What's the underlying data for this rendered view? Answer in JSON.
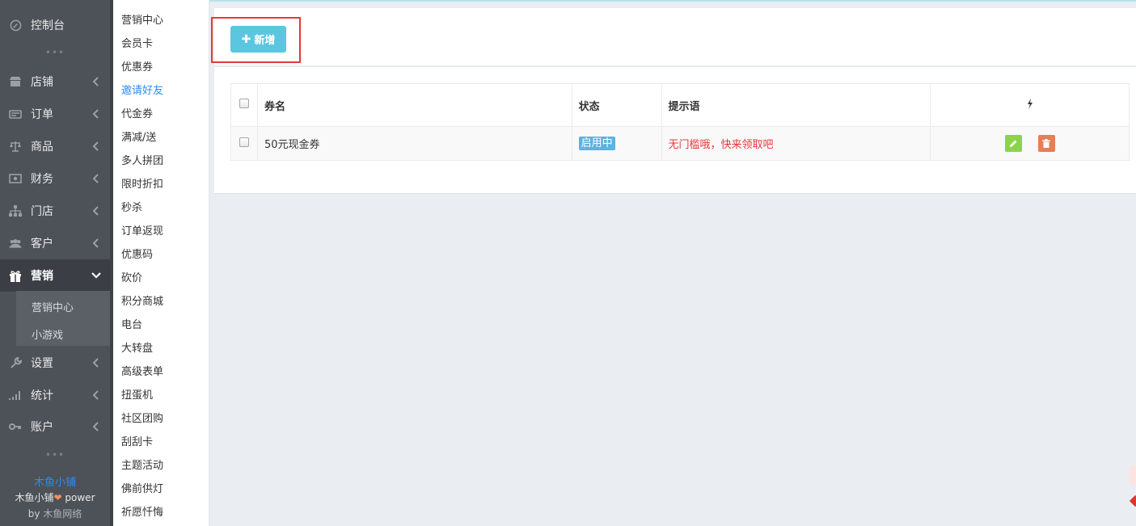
{
  "sidebar": {
    "items": [
      {
        "label": "控制台",
        "icon": "dashboard-icon",
        "has_chevron": false
      },
      {
        "label": "店铺",
        "icon": "shop-icon",
        "has_chevron": true
      },
      {
        "label": "订单",
        "icon": "order-icon",
        "has_chevron": true
      },
      {
        "label": "商品",
        "icon": "scale-icon",
        "has_chevron": true
      },
      {
        "label": "财务",
        "icon": "money-icon",
        "has_chevron": true
      },
      {
        "label": "门店",
        "icon": "sitemap-icon",
        "has_chevron": true
      },
      {
        "label": "客户",
        "icon": "users-icon",
        "has_chevron": true
      },
      {
        "label": "营销",
        "icon": "gift-icon",
        "has_chevron": true,
        "active": true
      },
      {
        "label": "设置",
        "icon": "wrench-icon",
        "has_chevron": true
      },
      {
        "label": "统计",
        "icon": "signal-icon",
        "has_chevron": true
      },
      {
        "label": "账户",
        "icon": "key-icon",
        "has_chevron": true
      }
    ],
    "sub_items": [
      "营销中心",
      "小游戏"
    ],
    "dots": "•••",
    "footer": {
      "brand": "木鱼小铺",
      "power_prefix": "木鱼小铺",
      "power_suffix": "power",
      "by_prefix": "by",
      "by_name": "木鱼网络"
    }
  },
  "submenu": {
    "items": [
      "营销中心",
      "会员卡",
      "优惠券",
      "邀请好友",
      "代金券",
      "满减/送",
      "多人拼团",
      "限时折扣",
      "秒杀",
      "订单返现",
      "优惠码",
      "砍价",
      "积分商城",
      "电台",
      "大转盘",
      "高级表单",
      "扭蛋机",
      "社区团购",
      "刮刮卡",
      "主题活动",
      "佛前供灯",
      "祈愿忏悔"
    ],
    "current": "邀请好友"
  },
  "toolbar": {
    "add_label": "新增"
  },
  "table": {
    "headers": {
      "name": "券名",
      "status": "状态",
      "hint": "提示语",
      "actions_icon": "lightning-icon"
    },
    "rows": [
      {
        "name": "50元现金券",
        "status": "启用中",
        "hint": "无门槛哦，快来领取吧"
      }
    ]
  },
  "colors": {
    "sidebar_bg": "#4d5259",
    "accent_button": "#5bc6df",
    "highlight_border": "#e4393c",
    "status_badge": "#5bb3e0",
    "hint_text": "#e4393c",
    "edit_button": "#8dd34a",
    "delete_button": "#e47f56"
  }
}
